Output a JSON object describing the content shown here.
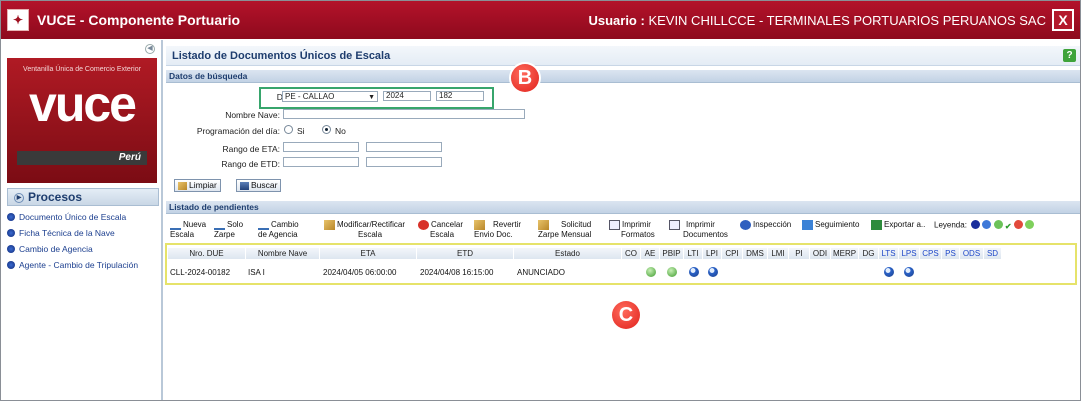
{
  "window": {
    "title": "VUCE - Componente Portuario",
    "user_label": "Usuario :",
    "user_value": "KEVIN CHILLCCE - TERMINALES PORTUARIOS PERUANOS SAC",
    "close": "X"
  },
  "sidebar": {
    "logo_top": "Ventanilla Única de Comercio Exterior",
    "logo_big": "vuce",
    "logo_country": "Perú",
    "processes_title": "Procesos",
    "items": [
      {
        "label": "Documento Único de Escala"
      },
      {
        "label": "Ficha Técnica de la Nave"
      },
      {
        "label": "Cambio de Agencia"
      },
      {
        "label": "Agente - Cambio de Tripulación"
      }
    ]
  },
  "page": {
    "title": "Listado de Documentos Únicos de Escala",
    "help": "?"
  },
  "search": {
    "section_title": "Datos de búsqueda",
    "due_label": "DUE:",
    "due_port": "PE - CALLAO",
    "due_year": "2024",
    "due_number": "182",
    "ship_label": "Nombre Nave:",
    "schedule_label": "Programación del día:",
    "opt_yes": "Si",
    "opt_no": "No",
    "eta_label": "Rango de ETA:",
    "etd_label": "Rango de ETD:",
    "clear_button": "Limpiar",
    "search_button": "Buscar"
  },
  "pending": {
    "section_title": "Listado de pendientes",
    "toolbar": [
      {
        "line1": "Nueva",
        "line2": "Escala"
      },
      {
        "line1": "Solo",
        "line2": "Zarpe"
      },
      {
        "line1": "Cambio",
        "line2": "de Agencia"
      },
      {
        "line1": "Modificar/Rectificar",
        "line2": "Escala"
      },
      {
        "line1": "Cancelar",
        "line2": "Escala"
      },
      {
        "line1": "Revertir",
        "line2": "Envio Doc."
      },
      {
        "line1": "Solicitud",
        "line2": "Zarpe Mensual"
      },
      {
        "line1": "Imprimir",
        "line2": "Formatos"
      },
      {
        "line1": "Imprimir",
        "line2": "Documentos"
      },
      {
        "line1": "Inspección",
        "line2": ""
      },
      {
        "line1": "Seguimiento",
        "line2": ""
      },
      {
        "line1": "Exportar a..",
        "line2": ""
      }
    ],
    "legend_label": "Leyenda:",
    "columns": [
      "Nro. DUE",
      "Nombre Nave",
      "ETA",
      "ETD",
      "Estado",
      "CO",
      "AE",
      "PBIP",
      "LTI",
      "LPI",
      "CPI",
      "DMS",
      "LMI",
      "PI",
      "ODI",
      "MERP",
      "DG",
      "LTS",
      "LPS",
      "CPS",
      "PS",
      "ODS",
      "SD"
    ],
    "row": {
      "due": "CLL-2024-00182",
      "ship": "ISA I",
      "eta": "2024/04/05 06:00:00",
      "etd": "2024/04/08 16:15:00",
      "status": "ANUNCIADO"
    }
  },
  "markers": {
    "b": "B",
    "c": "C"
  },
  "colors": {
    "brand_red": "#a50f24",
    "section_blue": "#1e3d6e",
    "highlight_green": "#37a56c",
    "highlight_yellow": "#e6e36a",
    "marker_red": "#e0221c"
  }
}
